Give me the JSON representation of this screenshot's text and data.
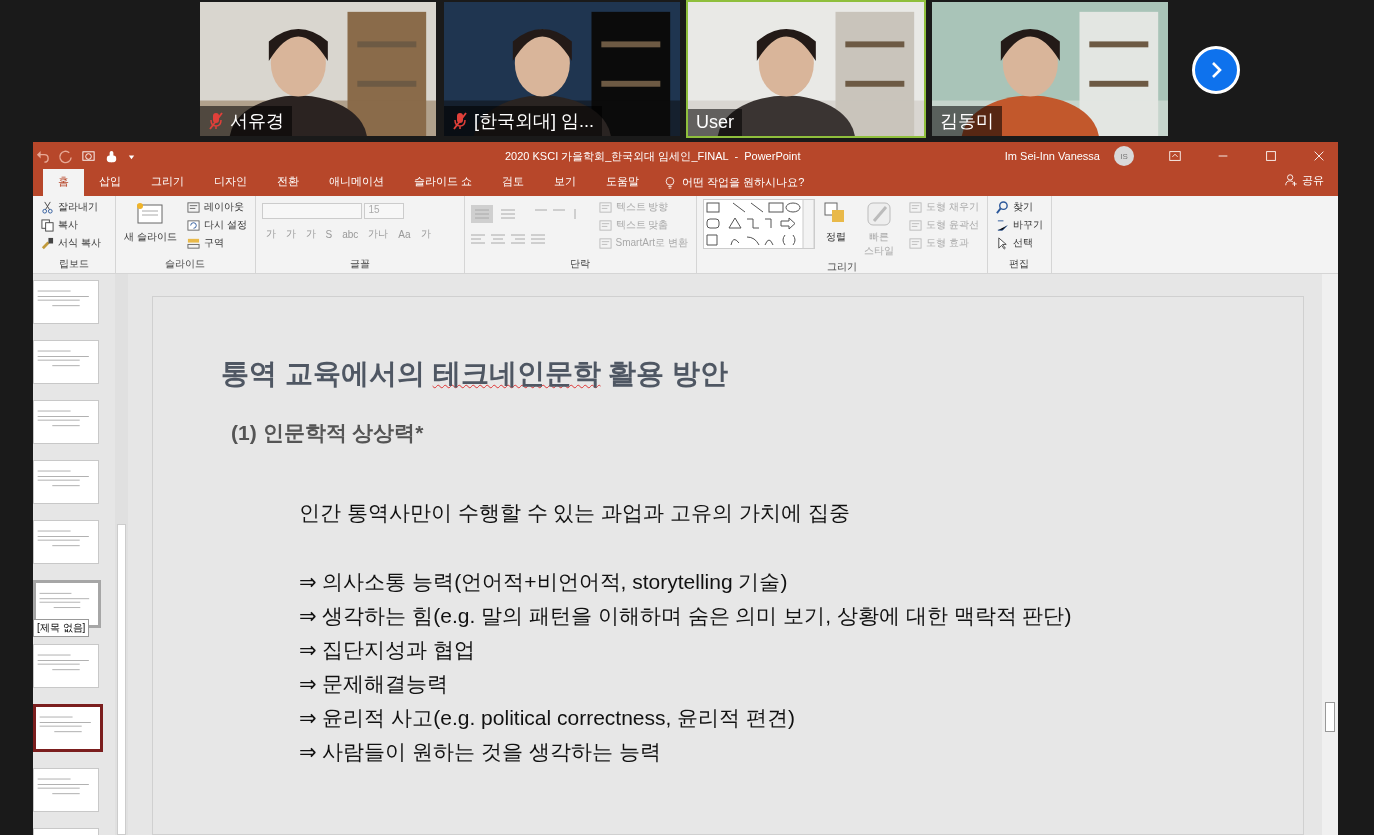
{
  "participants": [
    {
      "name": "서유경",
      "muted": true,
      "speaking": false
    },
    {
      "name": "[한국외대] 임...",
      "muted": true,
      "speaking": false
    },
    {
      "name": "User",
      "muted": false,
      "speaking": true
    },
    {
      "name": "김동미",
      "muted": false,
      "speaking": false
    }
  ],
  "powerpoint": {
    "title": "2020 KSCI 가을학회_한국외대 임세인_FINAL  -  PowerPoint",
    "user": "Im Sei-Inn Vanessa",
    "initials": "IS",
    "share": "공유",
    "tell_me": "어떤 작업을 원하시나요?",
    "tabs": [
      {
        "label": "홈",
        "selected": true
      },
      {
        "label": "삽입",
        "selected": false
      },
      {
        "label": "그리기",
        "selected": false
      },
      {
        "label": "디자인",
        "selected": false
      },
      {
        "label": "전환",
        "selected": false
      },
      {
        "label": "애니메이션",
        "selected": false
      },
      {
        "label": "슬라이드 쇼",
        "selected": false
      },
      {
        "label": "검토",
        "selected": false
      },
      {
        "label": "보기",
        "selected": false
      },
      {
        "label": "도움말",
        "selected": false
      }
    ],
    "groups": [
      {
        "label": "립보드",
        "kind": "clipboard",
        "commands": [
          {
            "label": "잘라내기",
            "kind": "scissors",
            "disabled": false
          },
          {
            "label": "복사",
            "kind": "copy",
            "disabled": false
          },
          {
            "label": "서식 복사",
            "kind": "brush",
            "disabled": false
          }
        ]
      },
      {
        "label": "슬라이드",
        "kind": "slides",
        "big": "새 슬라이드",
        "commands": [
          {
            "label": "레이아웃",
            "kind": "layout",
            "disabled": false
          },
          {
            "label": "다시 설정",
            "kind": "reset",
            "disabled": false
          },
          {
            "label": "구역",
            "kind": "section",
            "disabled": false
          }
        ]
      },
      {
        "label": "글꼴",
        "kind": "font",
        "size": "15",
        "glyphs": [
          "가",
          "가",
          "가",
          "S",
          "abc",
          "가나",
          "Aa",
          "가"
        ]
      },
      {
        "label": "단락",
        "kind": "paragraph",
        "commands": [
          {
            "label": "텍스트 방향",
            "kind": "textdir",
            "disabled": true
          },
          {
            "label": "텍스트 맞춤",
            "kind": "align",
            "disabled": true
          },
          {
            "label": "SmartArt로 변환",
            "kind": "smartart",
            "disabled": true
          }
        ]
      },
      {
        "label": "그리기",
        "kind": "drawing",
        "arrange": "정렬",
        "quick": "빠른 스타일",
        "commands": [
          {
            "label": "도형 채우기",
            "kind": "fill",
            "disabled": true
          },
          {
            "label": "도형 윤곽선",
            "kind": "outline",
            "disabled": true
          },
          {
            "label": "도형 효과",
            "kind": "effect",
            "disabled": true
          }
        ]
      },
      {
        "label": "편집",
        "kind": "editing",
        "commands": [
          {
            "label": "찾기",
            "kind": "search",
            "disabled": false
          },
          {
            "label": "바꾸기",
            "kind": "replace",
            "disabled": false
          },
          {
            "label": "선택",
            "kind": "cursor",
            "disabled": false
          }
        ]
      }
    ],
    "thumbnails": [
      {
        "selected": false,
        "hovered": false
      },
      {
        "selected": false,
        "hovered": false
      },
      {
        "selected": false,
        "hovered": false
      },
      {
        "selected": false,
        "hovered": false
      },
      {
        "selected": false,
        "hovered": false
      },
      {
        "selected": false,
        "hovered": true
      },
      {
        "selected": false,
        "hovered": false
      },
      {
        "selected": true,
        "hovered": false
      },
      {
        "selected": false,
        "hovered": false
      },
      {
        "selected": false,
        "hovered": false
      }
    ],
    "tooltip": "[제목 없음]",
    "slide": {
      "title": [
        {
          "text": "통역 교육에서의 ",
          "misspelled": false
        },
        {
          "text": "테크네인문학",
          "misspelled": true
        },
        {
          "text": " 활용 방안",
          "misspelled": false
        }
      ],
      "subtitle": "(1) 인문학적 상상력*",
      "intro": "인간 통역사만이 수행할 수 있는 과업과 고유의 가치에 집중",
      "points": [
        "⇒ 의사소통 능력(언어적+비언어적, storytelling 기술)",
        "⇒ 생각하는 힘(e.g. 말의 패턴을 이해하며 숨은 의미 보기, 상황에 대한 맥락적 판단)",
        "⇒ 집단지성과 협업",
        "⇒ 문제해결능력",
        "⇒ 윤리적 사고(e.g. political correctness, 윤리적 편견)",
        "⇒ 사람들이 원하는 것을 생각하는 능력"
      ]
    }
  }
}
